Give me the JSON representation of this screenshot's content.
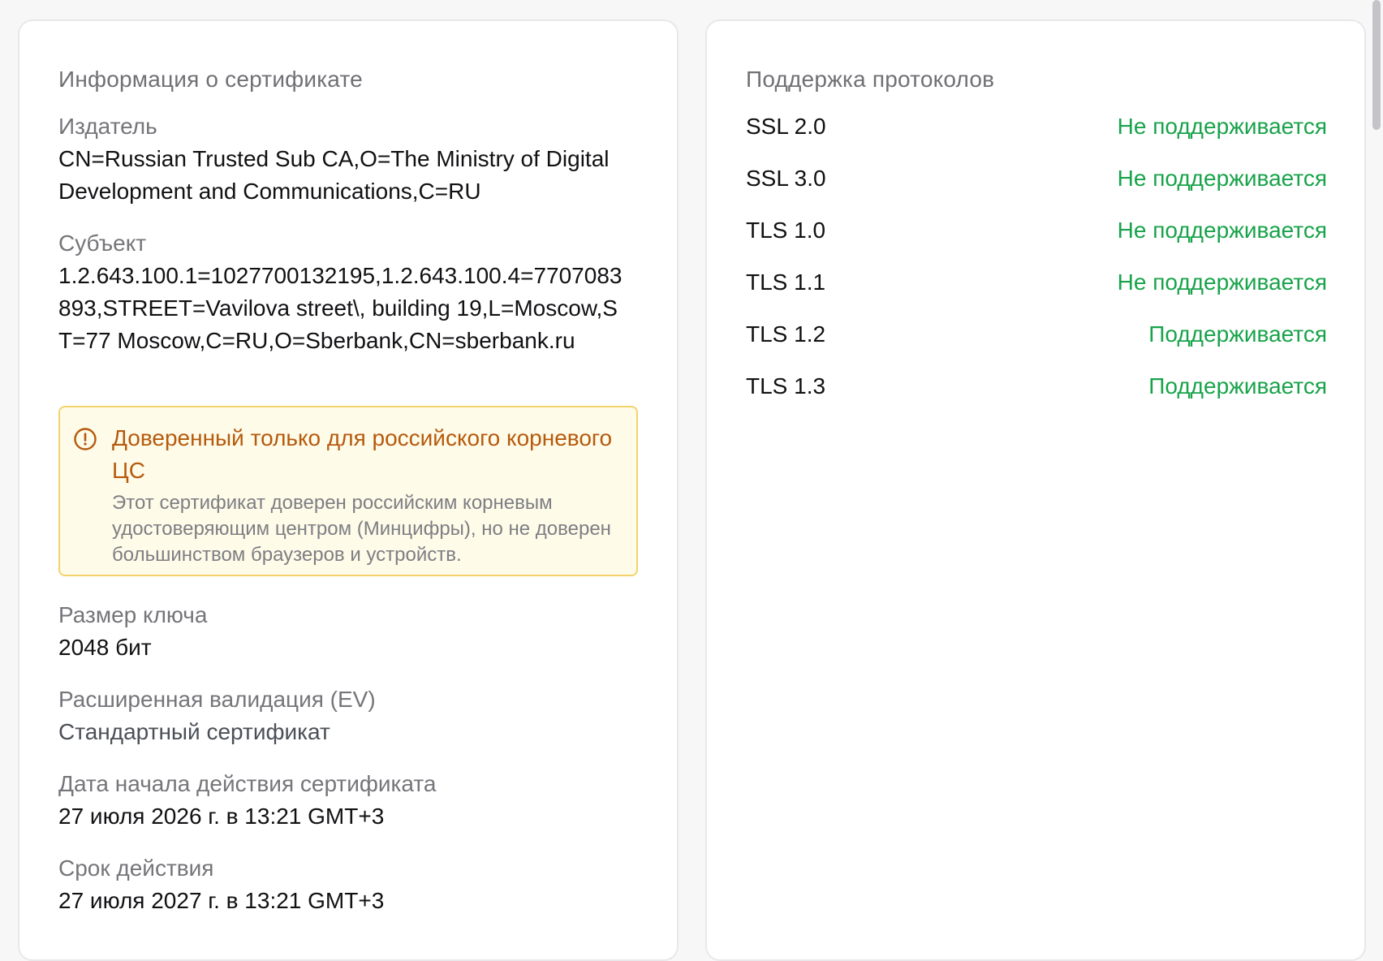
{
  "certificate": {
    "title": "Информация о сертификате",
    "issuer_label": "Издатель",
    "issuer_value": "CN=Russian Trusted Sub CA,O=The Ministry of Digital Development and Communications,C=RU",
    "subject_label": "Субъект",
    "subject_value": "1.2.643.100.1=1027700132195,1.2.643.100.4=7707083893,STREET=Vavilova street\\, building 19,L=Moscow,ST=77 Moscow,C=RU,O=Sberbank,CN=sberbank.ru",
    "warning": {
      "title": "Доверенный только для российского корневого ЦС",
      "text": "Этот сертификат доверен российским корневым удостоверяющим центром (Минцифры), но не доверен большинством браузеров и устройств.",
      "icon": "alert-circle-icon",
      "color": "#b65a0c"
    },
    "key_size_label": "Размер ключа",
    "key_size_value": "2048 бит",
    "ev_label": "Расширенная валидация (EV)",
    "ev_value": "Стандартный сертификат",
    "valid_from_label": "Дата начала действия сертификата",
    "valid_from_value": "27 июля 2026 г. в 13:21 GMT+3",
    "valid_to_label": "Срок действия",
    "valid_to_value": "27 июля 2027 г. в 13:21 GMT+3"
  },
  "protocols": {
    "title": "Поддержка протоколов",
    "status_color": "#18a34a",
    "items": [
      {
        "name": "SSL 2.0",
        "status": "Не поддерживается"
      },
      {
        "name": "SSL 3.0",
        "status": "Не поддерживается"
      },
      {
        "name": "TLS 1.0",
        "status": "Не поддерживается"
      },
      {
        "name": "TLS 1.1",
        "status": "Не поддерживается"
      },
      {
        "name": "TLS 1.2",
        "status": "Поддерживается"
      },
      {
        "name": "TLS 1.3",
        "status": "Поддерживается"
      }
    ]
  }
}
